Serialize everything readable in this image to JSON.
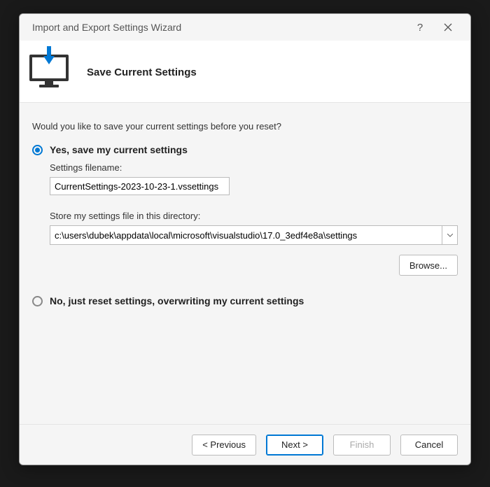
{
  "window": {
    "title": "Import and Export Settings Wizard"
  },
  "header": {
    "title": "Save Current Settings"
  },
  "body": {
    "prompt": "Would you like to save your current settings before you reset?",
    "option_yes": "Yes, save my current settings",
    "filename_label": "Settings filename:",
    "filename_value": "CurrentSettings-2023-10-23-1.vssettings",
    "directory_label": "Store my settings file in this directory:",
    "directory_value": "c:\\users\\dubek\\appdata\\local\\microsoft\\visualstudio\\17.0_3edf4e8a\\settings",
    "browse_label": "Browse...",
    "option_no": "No, just reset settings, overwriting my current settings"
  },
  "footer": {
    "previous": "< Previous",
    "next": "Next >",
    "finish": "Finish",
    "cancel": "Cancel"
  }
}
